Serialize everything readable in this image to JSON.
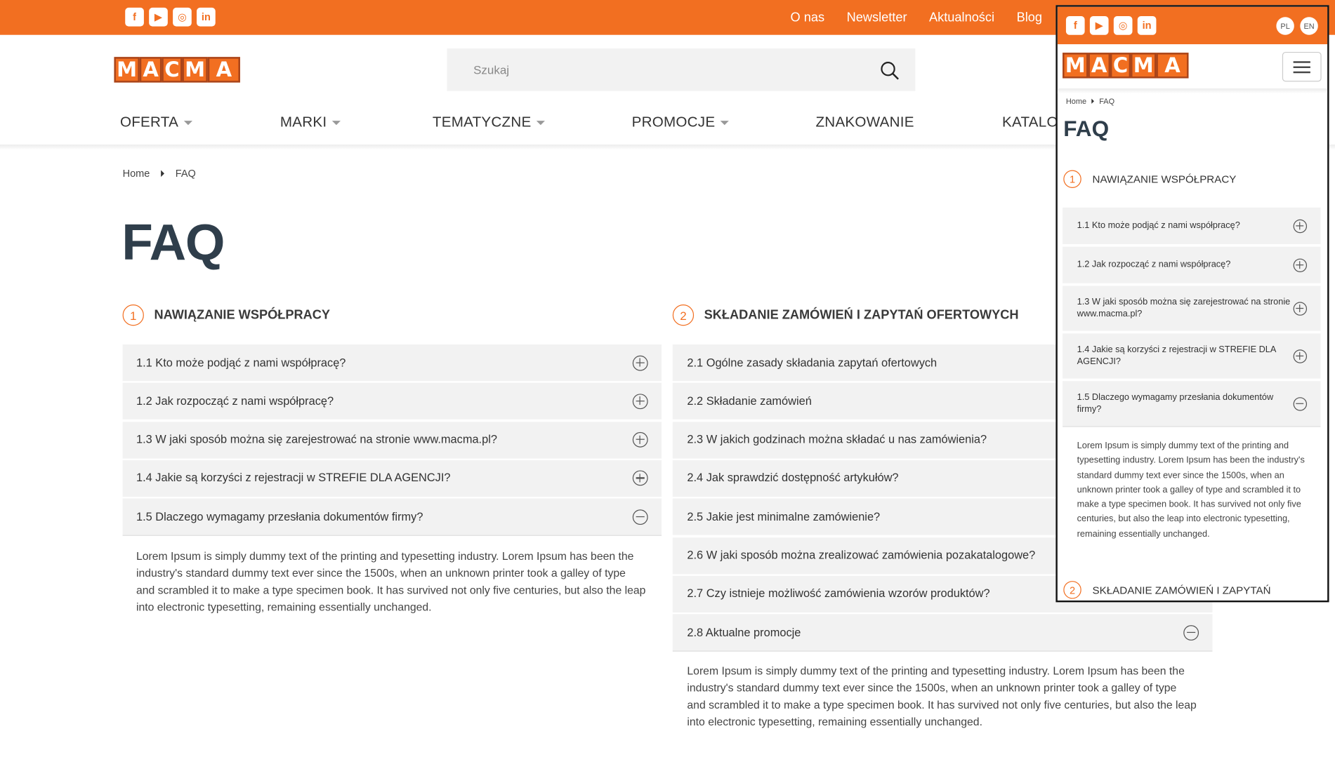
{
  "colors": {
    "brand": "#f26f21",
    "title": "#2f3e4b",
    "panel": "#f2f2f2"
  },
  "social": [
    "facebook-icon",
    "youtube-icon",
    "instagram-icon",
    "linkedin-icon"
  ],
  "topnav": [
    "O nas",
    "Newsletter",
    "Aktualności",
    "Blog"
  ],
  "logo": "MACMA",
  "search": {
    "placeholder": "Szukaj"
  },
  "mainnav": [
    "OFERTA",
    "MARKI",
    "TEMATYCZNE",
    "PROMOCJE",
    "ZNAKOWANIE",
    "KATALOGI"
  ],
  "breadcrumb": [
    "Home",
    "FAQ"
  ],
  "page_title": "FAQ",
  "sections": [
    {
      "number": "1",
      "title": "NAWIĄZANIE WSPÓŁPRACY",
      "items": [
        {
          "q": "1.1 Kto może podjąć z nami współpracę?",
          "open": false
        },
        {
          "q": "1.2 Jak rozpocząć z nami współpracę?",
          "open": false
        },
        {
          "q": "1.3 W jaki sposób można się zarejestrować na stronie www.macma.pl?",
          "open": false
        },
        {
          "q": "1.4 Jakie są korzyści z rejestracji w STREFIE DLA AGENCJI?",
          "open": false
        },
        {
          "q": "1.5 Dlaczego wymagamy przesłania dokumentów firmy?",
          "open": true
        }
      ],
      "answer": "Lorem Ipsum is simply dummy text of the printing and typesetting industry. Lorem Ipsum has been the industry's standard dummy text ever since the 1500s, when an unknown printer took a galley of type and scrambled it to make a type specimen book. It has survived not only five centuries, but also the leap into electronic typesetting, remaining essentially unchanged."
    },
    {
      "number": "2",
      "title": "SKŁADANIE ZAMÓWIEŃ I ZAPYTAŃ OFERTOWYCH",
      "items": [
        {
          "q": "2.1 Ogólne zasady składania zapytań ofertowych",
          "open": false
        },
        {
          "q": "2.2 Składanie zamówień",
          "open": false
        },
        {
          "q": "2.3 W jakich godzinach można składać u nas zamówienia?",
          "open": false
        },
        {
          "q": "2.4 Jak sprawdzić dostępność artykułów?",
          "open": false
        },
        {
          "q": "2.5 Jakie jest minimalne zamówienie?",
          "open": false
        },
        {
          "q": "2.6 W jaki sposób można zrealizować zamówienia pozakatalogowe?",
          "open": false
        },
        {
          "q": "2.7 Czy istnieje możliwość zamówienia wzorów produktów?",
          "open": false
        },
        {
          "q": "2.8 Aktualne promocje",
          "open": true
        }
      ],
      "answer": "Lorem Ipsum is simply dummy text of the printing and typesetting industry. Lorem Ipsum has been the industry's standard dummy text ever since the 1500s, when an unknown printer took a galley of type and scrambled it to make a type specimen book. It has survived not only five centuries, but also the leap into electronic typesetting, remaining essentially unchanged."
    }
  ],
  "mobile": {
    "languages": [
      "PL",
      "EN"
    ],
    "section2_title_partial": "SKŁADANIE ZAMÓWIEŃ I ZAPYTAŃ"
  }
}
